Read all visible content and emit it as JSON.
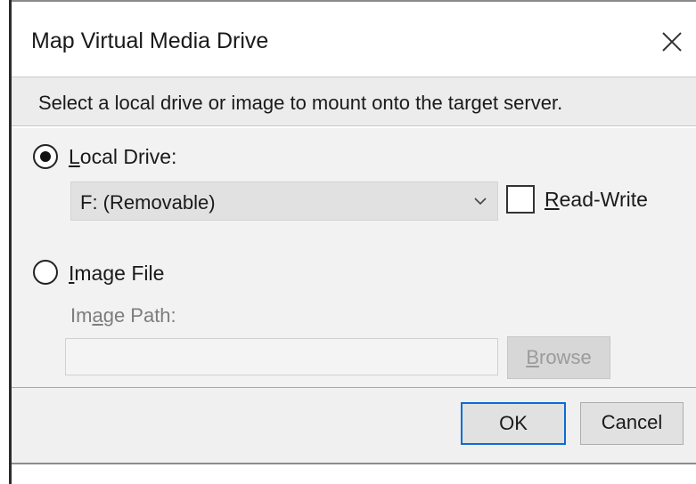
{
  "dialog": {
    "title": "Map Virtual Media Drive",
    "close_icon": "close-icon"
  },
  "description": "Select a local drive or image to mount onto the target server.",
  "local_drive": {
    "label_first": "L",
    "label_rest": "ocal Drive:",
    "selected": true,
    "drive_value": "F: (Removable)",
    "read_write_first": "R",
    "read_write_rest": "ead-Write",
    "read_write_checked": false
  },
  "image_file": {
    "label_first": "I",
    "label_rest": "mage File",
    "selected": false,
    "path_label_a": "Im",
    "path_label_u": "a",
    "path_label_b": "ge Path:",
    "path_value": "",
    "browse_first": "B",
    "browse_rest": "rowse"
  },
  "buttons": {
    "ok": "OK",
    "cancel": "Cancel"
  }
}
